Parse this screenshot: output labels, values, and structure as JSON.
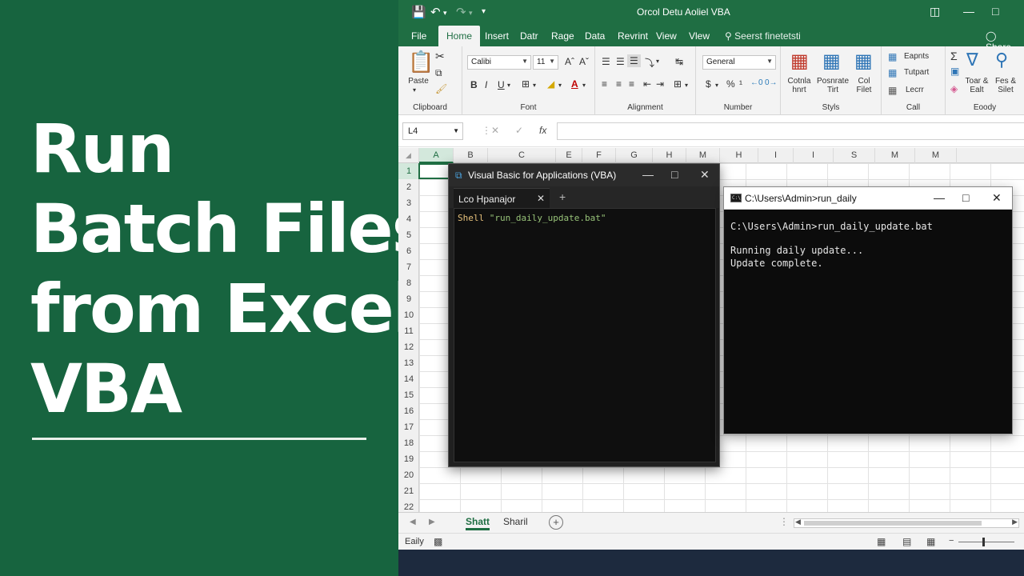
{
  "banner": {
    "title_lines": [
      "Run",
      "Batch Files",
      "from Excel",
      "VBA"
    ]
  },
  "excel": {
    "window_title": "Orcol Detu Aoliel VBA",
    "tabs": [
      "File",
      "Home",
      "Insert",
      "Datr",
      "Rage",
      "Data",
      "Revrint",
      "View",
      "Vlew"
    ],
    "search_placeholder": "Seerst finetetsti",
    "share_label": "Share",
    "ribbon": {
      "clipboard": {
        "paste": "Paste",
        "label": "Clipboard"
      },
      "font": {
        "name": "Calibi",
        "size": "11",
        "bold": "B",
        "italic": "I",
        "underline": "U",
        "label": "Font"
      },
      "alignment": {
        "label": "Alignment"
      },
      "number": {
        "format": "General",
        "label": "Number"
      },
      "styles": {
        "item1": "Cotnla hnrt",
        "item2": "Posnrate Tirt",
        "item3": "Col Filet",
        "label": "Styls"
      },
      "cells": {
        "item1": "Eapnts",
        "item2": "Tutpart",
        "item3": "Lecrr",
        "label": "Call"
      },
      "editing": {
        "item1": "Toar & Ealt",
        "item2": "Fes & Silet",
        "label": "Eoody"
      }
    },
    "name_box": "L4",
    "columns": [
      "A",
      "B",
      "C",
      "E",
      "F",
      "G",
      "H",
      "M",
      "H",
      "I",
      "I",
      "S",
      "M",
      "M"
    ],
    "active_column": "A",
    "rows": [
      "1",
      "2",
      "3",
      "4",
      "5",
      "6",
      "7",
      "8",
      "9",
      "10",
      "11",
      "12",
      "13",
      "14",
      "15",
      "16",
      "17",
      "18",
      "19",
      "20",
      "21",
      "22"
    ],
    "active_row": "1",
    "sheets": [
      "Shatt",
      "Sharil"
    ],
    "active_sheet": "Shatt",
    "status": "Eaily"
  },
  "vba": {
    "title": "Visual Basic for Applications (VBA)",
    "tab_label": "Lco Hpanajor",
    "code_keyword": "Shell",
    "code_string": "\"run_daily_update.bat\""
  },
  "cmd": {
    "title": "C:\\Users\\Admin>run_daily",
    "lines": [
      "C:\\Users\\Admin>run_daily_update.bat",
      "",
      "Running daily update...",
      "Update complete."
    ]
  },
  "colors": {
    "banner_green": "#17643f",
    "excel_green": "#1f6e43",
    "code_keyword": "#e5c07b",
    "code_string": "#98c379"
  }
}
